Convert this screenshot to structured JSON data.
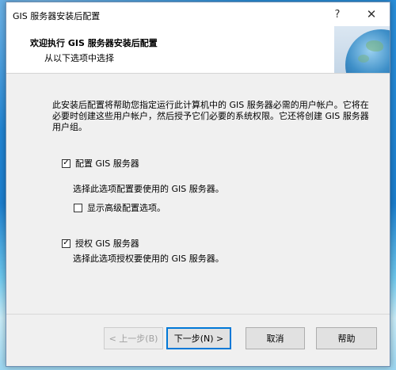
{
  "window": {
    "title": "GIS 服务器安装后配置",
    "help_glyph": "?",
    "close_glyph": "✕"
  },
  "header": {
    "title": "欢迎执行 GIS 服务器安装后配置",
    "subtitle": "从以下选项中选择"
  },
  "content": {
    "intro": "此安装后配置将帮助您指定运行此计算机中的 GIS 服务器必需的用户帐户。它将在必要时创建这些用户帐户，然后授予它们必要的系统权限。它还将创建 GIS 服务器用户组。",
    "options": [
      {
        "label": "配置 GIS 服务器",
        "checked": true,
        "check_glyph": "✓"
      },
      {
        "label": "显示高级配置选项。",
        "checked": false,
        "check_glyph": ""
      },
      {
        "label": "授权 GIS 服务器",
        "checked": true,
        "check_glyph": "✓"
      }
    ],
    "desc_configure": "选择此选项配置要使用的 GIS 服务器。",
    "desc_authorize": "选择此选项授权要使用的 GIS 服务器。"
  },
  "footer": {
    "back_label": "< 上一步(B)",
    "next_label": "下一步(N) >",
    "cancel_label": "取消",
    "help_label": "帮助"
  },
  "colors": {
    "accent": "#0078d7",
    "dialog_bg": "#f0f0f0"
  }
}
